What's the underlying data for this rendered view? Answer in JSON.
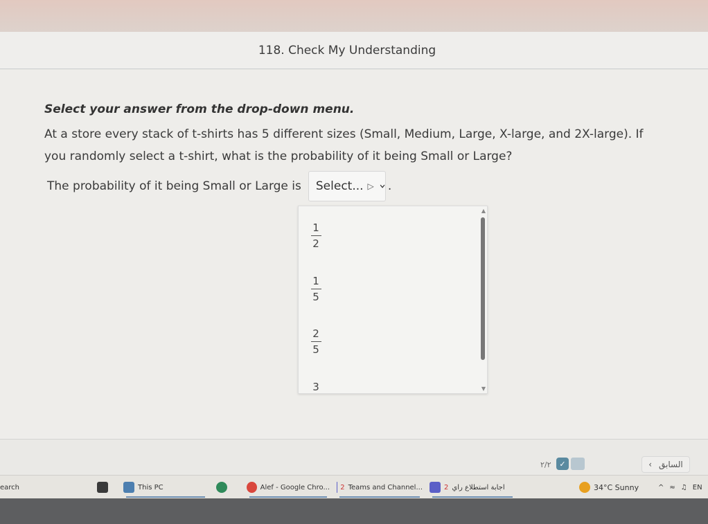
{
  "header": {
    "title": "118. Check My Understanding"
  },
  "question": {
    "instruction": "Select your answer from the drop-down menu.",
    "text": "At a store every stack of t-shirts has 5 different sizes (Small, Medium, Large, X-large, and 2X-large). If you randomly select a t-shirt, what is the probability of it being Small or Large?",
    "prompt": "The probability of it being Small or Large is",
    "select_placeholder": "Select...",
    "period": "."
  },
  "dropdown": {
    "options": [
      {
        "num": "1",
        "den": "2"
      },
      {
        "num": "1",
        "den": "5"
      },
      {
        "num": "2",
        "den": "5"
      },
      {
        "value": "3"
      }
    ]
  },
  "footer": {
    "page": "٢/٢",
    "prev_label": "السابق",
    "prev_arrow": "‹"
  },
  "taskbar": {
    "search": "earch",
    "this_pc": "This PC",
    "chrome": "Alef - Google Chro...",
    "teams": "Teams and Channel...",
    "teams_badge": "2",
    "arabic_app": "اجابة استطلاع راي",
    "arabic_badge": "2",
    "weather": "34°C  Sunny",
    "tray": "^",
    "lang": "EN"
  },
  "colors": {
    "accent": "#6d8fb3",
    "check": "#5a8aa0",
    "taskbar_dark": "#5d5e60"
  }
}
